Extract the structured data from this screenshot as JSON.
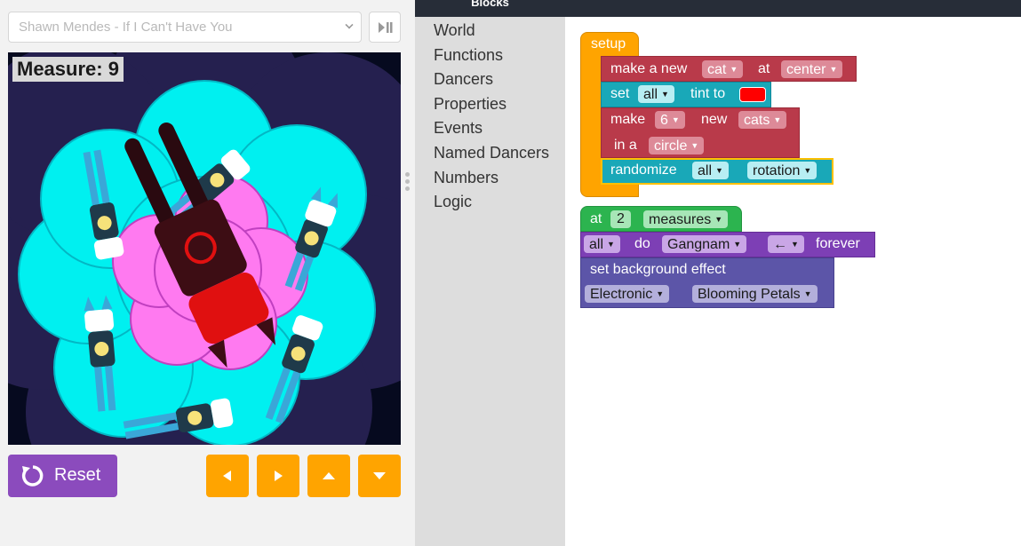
{
  "song": {
    "selected": "Shawn Mendes - If I Can't Have You"
  },
  "stage": {
    "measure_label": "Measure: 9"
  },
  "controls": {
    "reset_label": "Reset"
  },
  "toolbox": {
    "header": "Blocks",
    "categories": [
      "World",
      "Functions",
      "Dancers",
      "Properties",
      "Events",
      "Named Dancers",
      "Numbers",
      "Logic"
    ]
  },
  "blocks": {
    "setup": "setup",
    "make_a_new": "make a new",
    "cat": "cat",
    "at": "at",
    "center": "center",
    "set": "set",
    "all": "all",
    "tint_to": "tint to",
    "tint_color": "#ff0000",
    "make": "make",
    "six": "6",
    "new": "new",
    "cats": "cats",
    "in_a": "in a",
    "circle": "circle",
    "randomize": "randomize",
    "rotation": "rotation",
    "at2": "at",
    "two": "2",
    "measures": "measures",
    "do": "do",
    "gangnam": "Gangnam",
    "left_arrow": "←",
    "forever": "forever",
    "set_background_effect": "set background effect",
    "electronic": "Electronic",
    "blooming_petals": "Blooming Petals"
  },
  "colors": {
    "setup": "#ffa400",
    "red_block": "#b93a4a",
    "teal_block": "#19a8b8",
    "green_event": "#2cb44f",
    "purple_block": "#7d3fb5",
    "indigo_block": "#5c55a8",
    "reset_purple": "#8b4bbd",
    "arrow_orange": "#ffa400"
  }
}
